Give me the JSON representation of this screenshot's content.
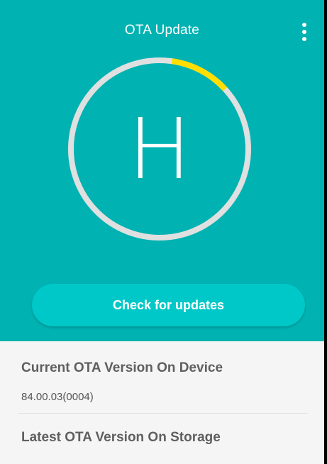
{
  "app": {
    "title": "OTA Update",
    "menu_icon": "more-vert-icon"
  },
  "status": {
    "letter": "H",
    "progress_fraction": 0.11
  },
  "actions": {
    "check_label": "Check for updates"
  },
  "info": {
    "current_title": "Current OTA Version On Device",
    "current_value": "84.00.03(0004)",
    "latest_title": "Latest OTA Version On Storage"
  },
  "colors": {
    "primary": "#00b2b2",
    "button": "#00c8c8",
    "ring_track": "#e0e0e0",
    "ring_progress": "#ffde00"
  }
}
